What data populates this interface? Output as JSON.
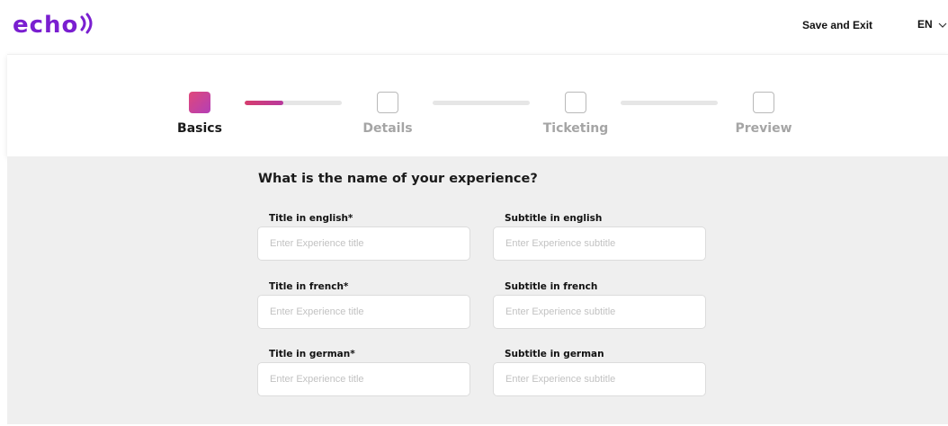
{
  "header": {
    "logo_text": "echo",
    "save_exit_label": "Save and Exit",
    "language": "EN",
    "brand_color": "#7a1fd0"
  },
  "stepper": {
    "active_color": "#d63d6e",
    "steps": [
      {
        "label": "Basics",
        "state": "active"
      },
      {
        "label": "Details",
        "state": "inactive"
      },
      {
        "label": "Ticketing",
        "state": "inactive"
      },
      {
        "label": "Preview",
        "state": "inactive"
      }
    ],
    "progress": [
      0.4,
      0,
      0
    ]
  },
  "form": {
    "question": "What is the name of your experience?",
    "rows": [
      {
        "title_label": "Title in english*",
        "title_placeholder": "Enter Experience title",
        "title_value": "",
        "subtitle_label": "Subtitle in english",
        "subtitle_placeholder": "Enter Experience subtitle",
        "subtitle_value": ""
      },
      {
        "title_label": "Title in french*",
        "title_placeholder": "Enter Experience title",
        "title_value": "",
        "subtitle_label": "Subtitle in french",
        "subtitle_placeholder": "Enter Experience subtitle",
        "subtitle_value": ""
      },
      {
        "title_label": "Title in german*",
        "title_placeholder": "Enter Experience title",
        "title_value": "",
        "subtitle_label": "Subtitle in german",
        "subtitle_placeholder": "Enter Experience subtitle",
        "subtitle_value": ""
      }
    ]
  }
}
